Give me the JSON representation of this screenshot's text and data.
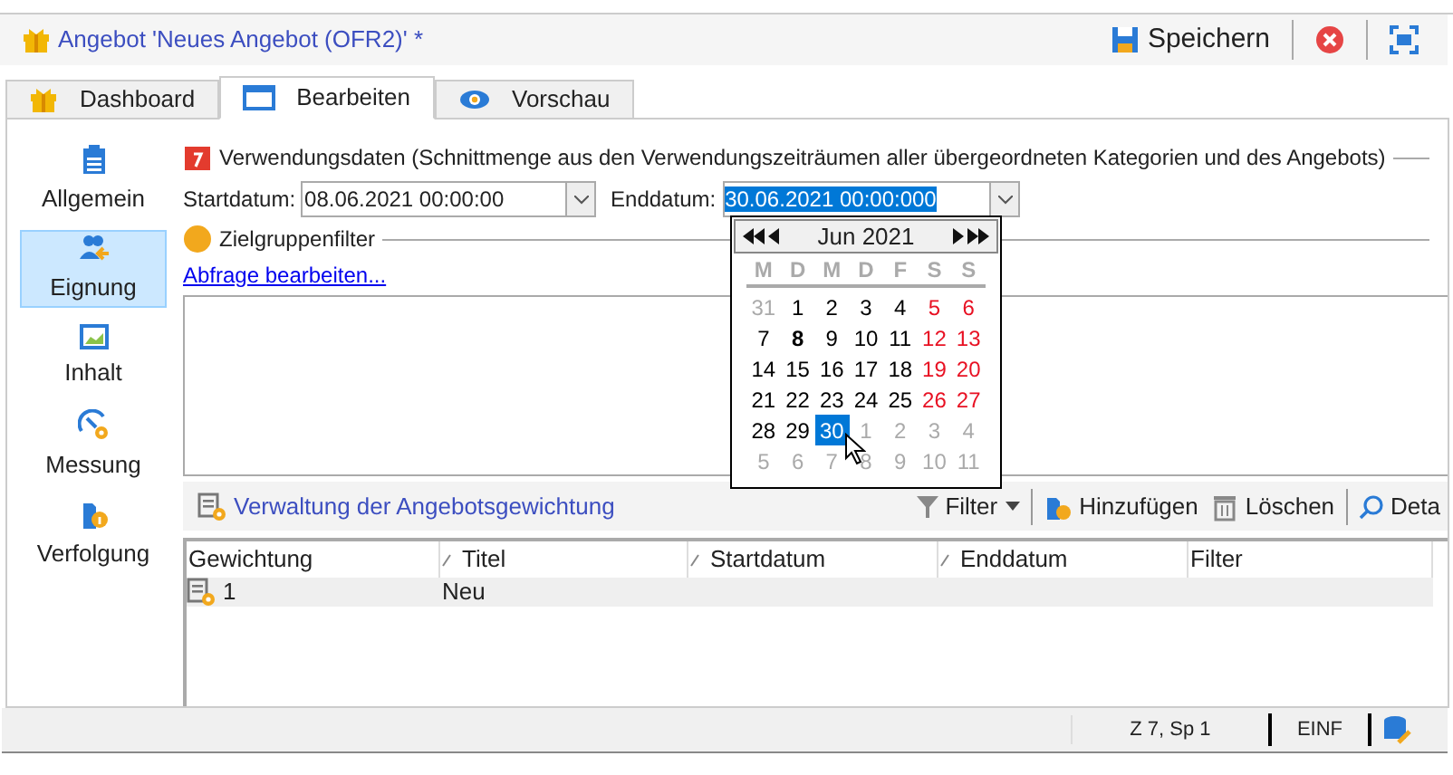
{
  "window": {
    "title": "Angebot 'Neues Angebot (OFR2)' *"
  },
  "header_buttons": [
    {
      "kind": "save",
      "label": "Speichern"
    },
    {
      "kind": "close"
    },
    {
      "kind": "maximize"
    }
  ],
  "tabs": [
    {
      "label": "Dashboard",
      "selected": false
    },
    {
      "label": "Bearbeiten",
      "selected": true
    },
    {
      "label": "Vorschau",
      "selected": false
    }
  ],
  "sidebar": {
    "items": [
      {
        "label": "Allgemein",
        "selected": false
      },
      {
        "label": "Eignung",
        "selected": true
      },
      {
        "label": "Inhalt",
        "selected": false
      },
      {
        "label": "Messung",
        "selected": false
      },
      {
        "label": "Verfolgung",
        "selected": false
      }
    ]
  },
  "usage_dates": {
    "title": "Verwendungsdaten (Schnittmenge aus den Verwendungszeiträumen aller übergeordneten Kategorien und des Angebots)",
    "start_label": "Startdatum:",
    "start_value": "08.06.2021 00:00:00",
    "end_label": "Enddatum:",
    "end_value": "30.06.2021 00:00:000"
  },
  "target_filter": {
    "title": "Zielgruppenfilter",
    "link": "Abfrage bearbeiten..."
  },
  "calendar": {
    "month": "Jun 2021",
    "weekdays": [
      "M",
      "D",
      "M",
      "D",
      "F",
      "S",
      "S"
    ],
    "weeks": [
      [
        {
          "day": "31",
          "kind": "other",
          "today": false,
          "selected": false
        },
        {
          "day": "1",
          "kind": "weekday",
          "today": false,
          "selected": false
        },
        {
          "day": "2",
          "kind": "weekday",
          "today": false,
          "selected": false
        },
        {
          "day": "3",
          "kind": "weekday",
          "today": false,
          "selected": false
        },
        {
          "day": "4",
          "kind": "weekday",
          "today": false,
          "selected": false
        },
        {
          "day": "5",
          "kind": "weekend",
          "today": false,
          "selected": false
        },
        {
          "day": "6",
          "kind": "weekend",
          "today": false,
          "selected": false
        }
      ],
      [
        {
          "day": "7",
          "kind": "weekday",
          "today": false,
          "selected": false
        },
        {
          "day": "8",
          "kind": "weekday",
          "today": true,
          "selected": false
        },
        {
          "day": "9",
          "kind": "weekday",
          "today": false,
          "selected": false
        },
        {
          "day": "10",
          "kind": "weekday",
          "today": false,
          "selected": false
        },
        {
          "day": "11",
          "kind": "weekday",
          "today": false,
          "selected": false
        },
        {
          "day": "12",
          "kind": "weekend",
          "today": false,
          "selected": false
        },
        {
          "day": "13",
          "kind": "weekend",
          "today": false,
          "selected": false
        }
      ],
      [
        {
          "day": "14",
          "kind": "weekday",
          "today": false,
          "selected": false
        },
        {
          "day": "15",
          "kind": "weekday",
          "today": false,
          "selected": false
        },
        {
          "day": "16",
          "kind": "weekday",
          "today": false,
          "selected": false
        },
        {
          "day": "17",
          "kind": "weekday",
          "today": false,
          "selected": false
        },
        {
          "day": "18",
          "kind": "weekday",
          "today": false,
          "selected": false
        },
        {
          "day": "19",
          "kind": "weekend",
          "today": false,
          "selected": false
        },
        {
          "day": "20",
          "kind": "weekend",
          "today": false,
          "selected": false
        }
      ],
      [
        {
          "day": "21",
          "kind": "weekday",
          "today": false,
          "selected": false
        },
        {
          "day": "22",
          "kind": "weekday",
          "today": false,
          "selected": false
        },
        {
          "day": "23",
          "kind": "weekday",
          "today": false,
          "selected": false
        },
        {
          "day": "24",
          "kind": "weekday",
          "today": false,
          "selected": false
        },
        {
          "day": "25",
          "kind": "weekday",
          "today": false,
          "selected": false
        },
        {
          "day": "26",
          "kind": "weekend",
          "today": false,
          "selected": false
        },
        {
          "day": "27",
          "kind": "weekend",
          "today": false,
          "selected": false
        }
      ],
      [
        {
          "day": "28",
          "kind": "weekday",
          "today": false,
          "selected": false
        },
        {
          "day": "29",
          "kind": "weekday",
          "today": false,
          "selected": false
        },
        {
          "day": "30",
          "kind": "weekday",
          "today": false,
          "selected": true
        },
        {
          "day": "1",
          "kind": "other",
          "today": false,
          "selected": false
        },
        {
          "day": "2",
          "kind": "other",
          "today": false,
          "selected": false
        },
        {
          "day": "3",
          "kind": "other",
          "today": false,
          "selected": false
        },
        {
          "day": "4",
          "kind": "other",
          "today": false,
          "selected": false
        }
      ],
      [
        {
          "day": "5",
          "kind": "other",
          "today": false,
          "selected": false
        },
        {
          "day": "6",
          "kind": "other",
          "today": false,
          "selected": false
        },
        {
          "day": "7",
          "kind": "other",
          "today": false,
          "selected": false
        },
        {
          "day": "8",
          "kind": "other",
          "today": false,
          "selected": false
        },
        {
          "day": "9",
          "kind": "other",
          "today": false,
          "selected": false
        },
        {
          "day": "10",
          "kind": "other",
          "today": false,
          "selected": false
        },
        {
          "day": "11",
          "kind": "other",
          "today": false,
          "selected": false
        }
      ]
    ]
  },
  "weighting": {
    "title": "Verwaltung der Angebotsgewichtung",
    "toolbar": [
      {
        "kind": "filter",
        "label": "Filter"
      },
      {
        "kind": "add",
        "label": "Hinzufügen"
      },
      {
        "kind": "delete",
        "label": "Löschen"
      },
      {
        "kind": "detail",
        "label": "Deta"
      }
    ],
    "table": {
      "columns": [
        "Gewichtung",
        "Titel",
        "Startdatum",
        "Enddatum",
        "Filter"
      ],
      "rows": [
        {
          "cells": [
            "1",
            "Neu",
            "",
            "",
            ""
          ]
        }
      ]
    }
  },
  "status_bar": {
    "position": "Z 7, Sp 1",
    "mode": "EINF"
  }
}
